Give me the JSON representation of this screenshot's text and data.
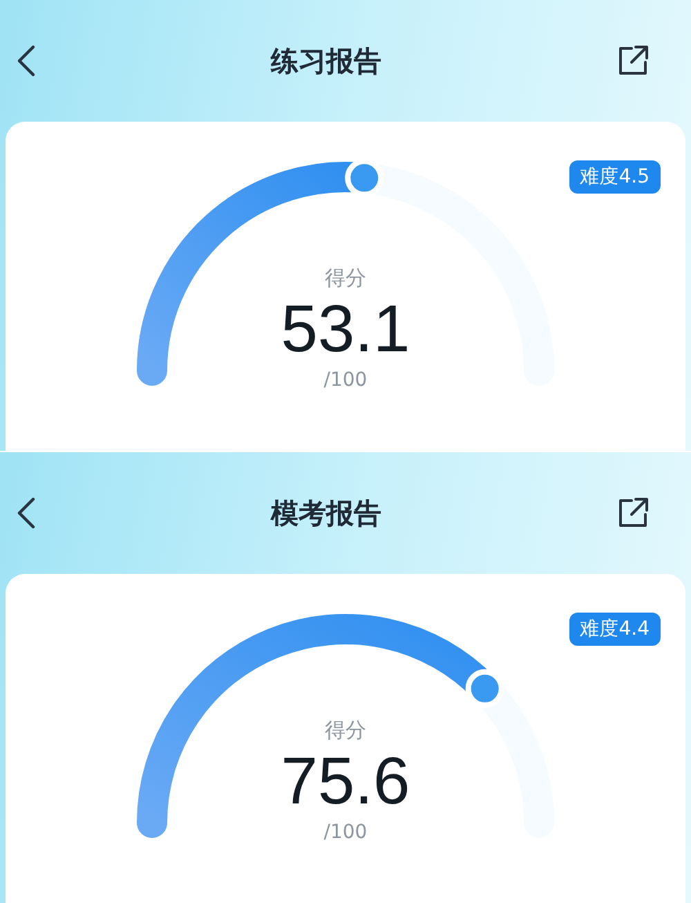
{
  "panels": [
    {
      "title": "练习报告",
      "difficulty": "难度4.5",
      "score_label": "得分",
      "score": "53.1",
      "max": "/100"
    },
    {
      "title": "模考报告",
      "difficulty": "难度4.4",
      "score_label": "得分",
      "score": "75.6",
      "max": "/100"
    }
  ]
}
